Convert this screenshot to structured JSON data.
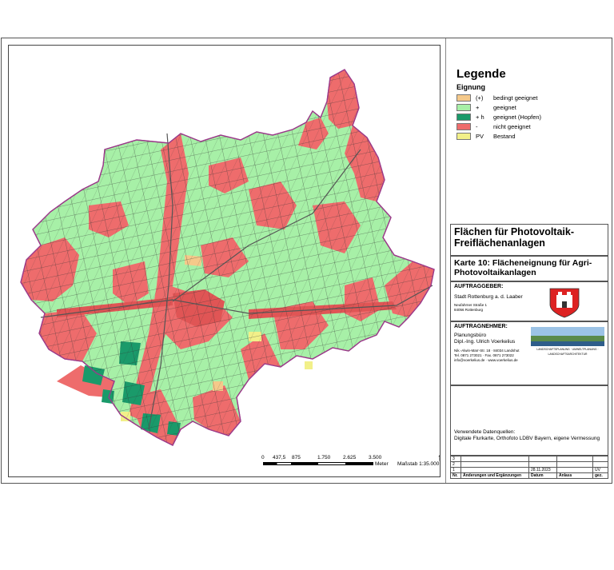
{
  "legend": {
    "title": "Legende",
    "subtitle": "Eignung",
    "items": [
      {
        "code": "(+)",
        "label": "bedingt geeignet",
        "color": "#f5c98a"
      },
      {
        "code": "+",
        "label": "geeignet",
        "color": "#a7f0a7"
      },
      {
        "code": "+ h",
        "label": "geeignet (Hopfen)",
        "color": "#1a9a6a"
      },
      {
        "code": "-",
        "label": "nicht geeignet",
        "color": "#ee6c6c"
      },
      {
        "code": "PV",
        "label": "Bestand",
        "color": "#f2f089"
      }
    ]
  },
  "title_block": {
    "title": "Flächen für Photovoltaik-Freiflächenanlagen",
    "map_title": "Karte 10: Flächeneignung für Agri-Photovoltaikanlagen"
  },
  "client": {
    "label": "AUFTRAGGEBER:",
    "name": "Stadt Rottenburg a. d. Laaber",
    "street": "Neufahrner Straße 1",
    "city": "84056 Rottenburg"
  },
  "contractor": {
    "label": "AUFTRAGNEHMER:",
    "firm": "Planungsbüro",
    "person": "Dipl.-Ing. Ulrich Voerkelius",
    "address": "Nik.-Alwin-Marr-Str. 18 · 84034 Landshut",
    "phone": "Tel. 0871 273021 · Fax. 0871 273022",
    "web": "info@voerkelius.de · www.voerkelius.de",
    "banner": "LANDSCHAFTSPLANUNG · UMWELTPLANUNG · LANDSCHAFTSARCHITEKTUR"
  },
  "sources": {
    "label": "Verwendete Datenquellen:",
    "text": "Digitale Flurkarte, Orthofoto LDBV Bayern, eigene Vermessung"
  },
  "revisions": {
    "rows": [
      {
        "no": "3",
        "change": "",
        "date": "",
        "reason": "",
        "by": ""
      },
      {
        "no": "2",
        "change": "",
        "date": "",
        "reason": "",
        "by": ""
      },
      {
        "no": "1",
        "change": "",
        "date": "28.11.2023",
        "reason": "",
        "by": "UV"
      }
    ],
    "header": {
      "no": "Nr.",
      "change": "Änderungen und Ergänzungen",
      "date": "Datum",
      "reason": "Anlass",
      "by": "gez."
    }
  },
  "scale": {
    "ticks": [
      "0",
      "437,5",
      "875",
      "1.750",
      "2.625",
      "3.500"
    ],
    "unit": "Meter",
    "ratio": "Maßstab 1:35.000"
  }
}
